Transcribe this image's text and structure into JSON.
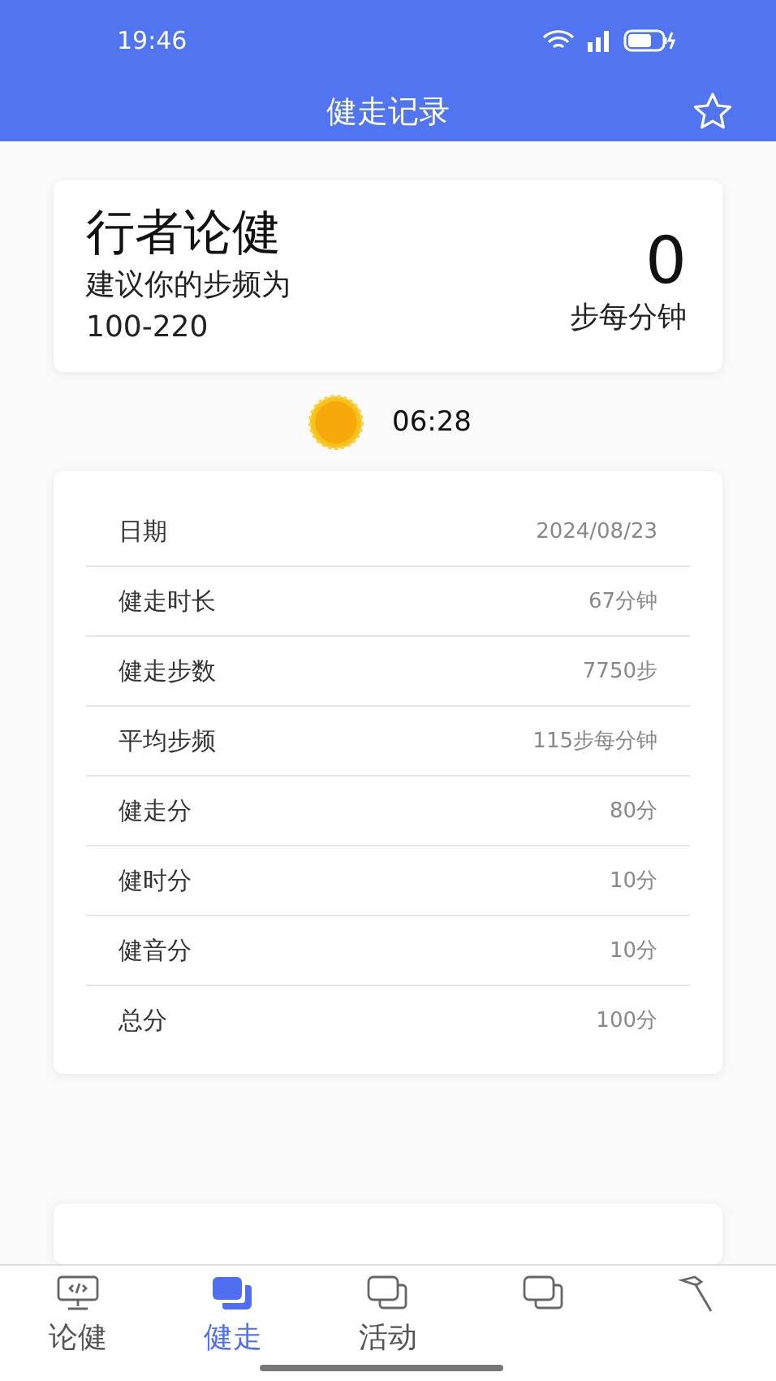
{
  "status_bar": {
    "time": "19:46"
  },
  "header": {
    "title": "健走记录"
  },
  "summary": {
    "title": "行者论健",
    "advice": "建议你的步频为",
    "range": "100-220",
    "cadence": "0",
    "unit": "步每分钟"
  },
  "sunrise": {
    "time": "06:28"
  },
  "records": [
    {
      "label": "日期",
      "value": "2024/08/23"
    },
    {
      "label": "健走时长",
      "value": "67分钟"
    },
    {
      "label": "健走步数",
      "value": "7750步"
    },
    {
      "label": "平均步频",
      "value": "115步每分钟"
    },
    {
      "label": "健走分",
      "value": "80分"
    },
    {
      "label": "健时分",
      "value": "10分"
    },
    {
      "label": "健音分",
      "value": "10分"
    },
    {
      "label": "总分",
      "value": "100分"
    }
  ],
  "tabs": [
    {
      "kind": "monitor",
      "label": "论健",
      "selected": false
    },
    {
      "kind": "stack",
      "label": "健走",
      "selected": true
    },
    {
      "kind": "stack",
      "label": "活动",
      "selected": false
    },
    {
      "kind": "stack",
      "selected": false
    },
    {
      "kind": "hammer",
      "selected": false
    }
  ]
}
